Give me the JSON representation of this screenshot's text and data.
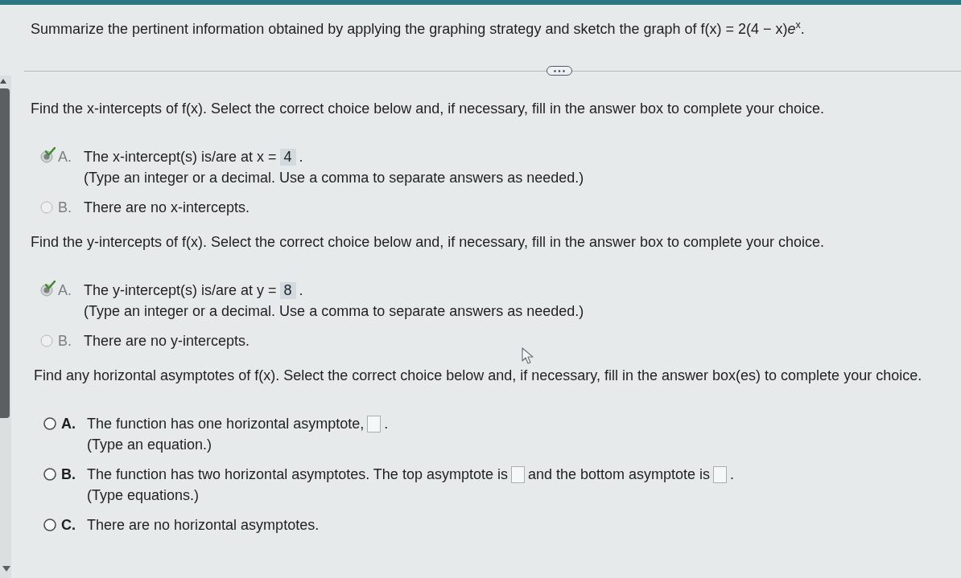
{
  "header": {
    "question": "Summarize the pertinent information obtained by applying the graphing strategy and sketch the graph of f(x) = 2(4 − x)*e*$^{x}$."
  },
  "questions": [
    {
      "prompt": "Find the x-intercepts of f(x). Select the correct choice below and, if necessary, fill in the answer box to complete your choice.",
      "answered": true,
      "choices": [
        {
          "letter": "A.",
          "selected": true,
          "correct": true,
          "segments": [
            {
              "kind": "text",
              "text": "The x-intercept(s) is/are at x ="
            },
            {
              "kind": "answer",
              "value": "4"
            },
            {
              "kind": "text",
              "text": "."
            }
          ],
          "hint": "(Type an integer or a decimal. Use a comma to separate answers as needed.)"
        },
        {
          "letter": "B.",
          "selected": false,
          "correct": false,
          "segments": [
            {
              "kind": "text",
              "text": "There are no x-intercepts."
            }
          ]
        }
      ]
    },
    {
      "prompt": "Find the y-intercepts of f(x). Select the correct choice below and, if necessary, fill in the answer box to complete your choice.",
      "answered": true,
      "choices": [
        {
          "letter": "A.",
          "selected": true,
          "correct": true,
          "segments": [
            {
              "kind": "text",
              "text": "The y-intercept(s) is/are at y ="
            },
            {
              "kind": "answer",
              "value": "8"
            },
            {
              "kind": "text",
              "text": "."
            }
          ],
          "hint": "(Type an integer or a decimal. Use a comma to separate answers as needed.)"
        },
        {
          "letter": "B.",
          "selected": false,
          "correct": false,
          "segments": [
            {
              "kind": "text",
              "text": "There are no y-intercepts."
            }
          ]
        }
      ]
    },
    {
      "prompt": "Find any horizontal asymptotes of f(x). Select the correct choice below and, if necessary, fill in the answer box(es) to complete your choice.",
      "answered": false,
      "choices": [
        {
          "letter": "A.",
          "selected": false,
          "correct": false,
          "segments": [
            {
              "kind": "text",
              "text": "The function has one horizontal asymptote,"
            },
            {
              "kind": "answer"
            },
            {
              "kind": "text",
              "text": "."
            }
          ],
          "hint": "(Type an equation.)"
        },
        {
          "letter": "B.",
          "selected": false,
          "correct": false,
          "segments": [
            {
              "kind": "text",
              "text": "The function has two horizontal asymptotes. The top asymptote is"
            },
            {
              "kind": "answer"
            },
            {
              "kind": "text",
              "text": "and the bottom asymptote is"
            },
            {
              "kind": "answer"
            },
            {
              "kind": "text",
              "text": "."
            }
          ],
          "hint": "(Type equations.)"
        },
        {
          "letter": "C.",
          "selected": false,
          "correct": false,
          "segments": [
            {
              "kind": "text",
              "text": "There are no horizontal asymptotes."
            }
          ]
        }
      ]
    }
  ]
}
